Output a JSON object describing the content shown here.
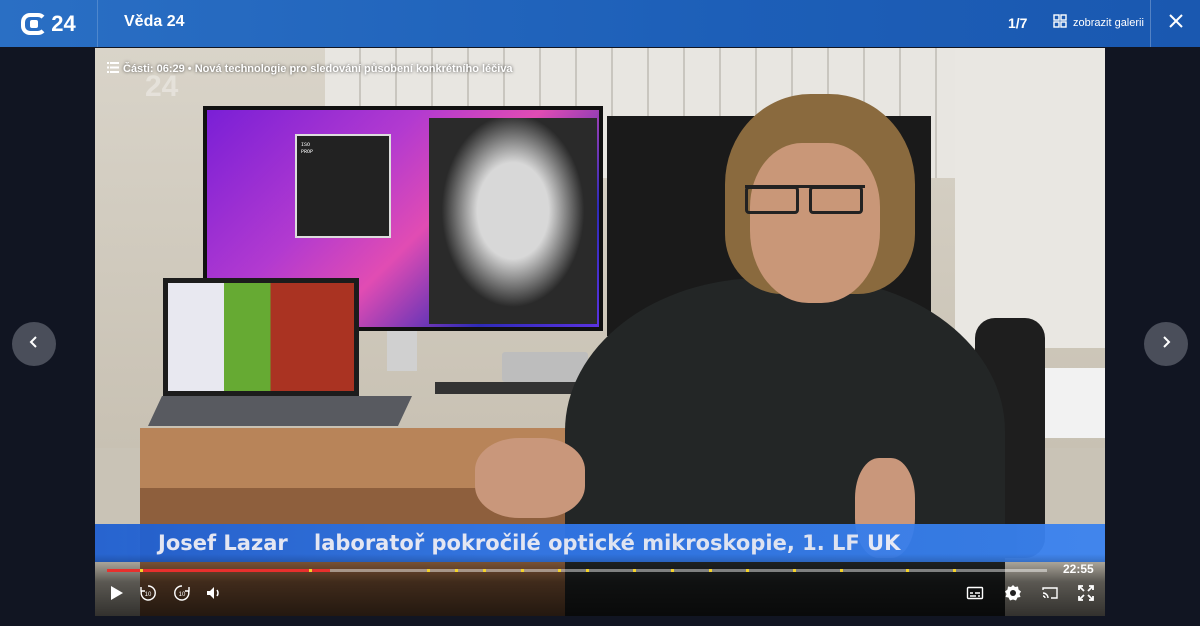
{
  "header": {
    "logo_text": "24",
    "title": "Věda 24",
    "counter": "1/7",
    "gallery_label": "zobrazit galerii",
    "icons": {
      "gallery": "grid-icon",
      "close": "close-icon"
    }
  },
  "navigation": {
    "prev_icon": "chevron-left-icon",
    "next_icon": "chevron-right-icon"
  },
  "video": {
    "watermark": "24",
    "chapter": {
      "icon": "list-icon",
      "label": "Části: 06:29 • Nová technologie pro sledování působení konkrétního léčiva"
    },
    "lower_third": {
      "name": "Josef Lazar",
      "role": "laboratoř pokročilé optické mikroskopie, 1. LF UK"
    },
    "popup_text": "ISO\nPROP"
  },
  "player": {
    "duration": "22:55",
    "progress_fraction": 0.237,
    "chapter_markers": [
      0.035,
      0.215,
      0.34,
      0.37,
      0.4,
      0.44,
      0.48,
      0.51,
      0.56,
      0.6,
      0.64,
      0.68,
      0.73,
      0.78,
      0.85,
      0.9
    ],
    "colors": {
      "progress": "#e8302d",
      "marker": "#f3d22a",
      "accent": "#1d5fb8"
    },
    "controls": [
      "play-icon",
      "rewind-10-icon",
      "forward-10-icon",
      "volume-icon",
      "subtitles-icon",
      "settings-icon",
      "cast-icon",
      "fullscreen-icon"
    ],
    "skip_label": "10"
  }
}
